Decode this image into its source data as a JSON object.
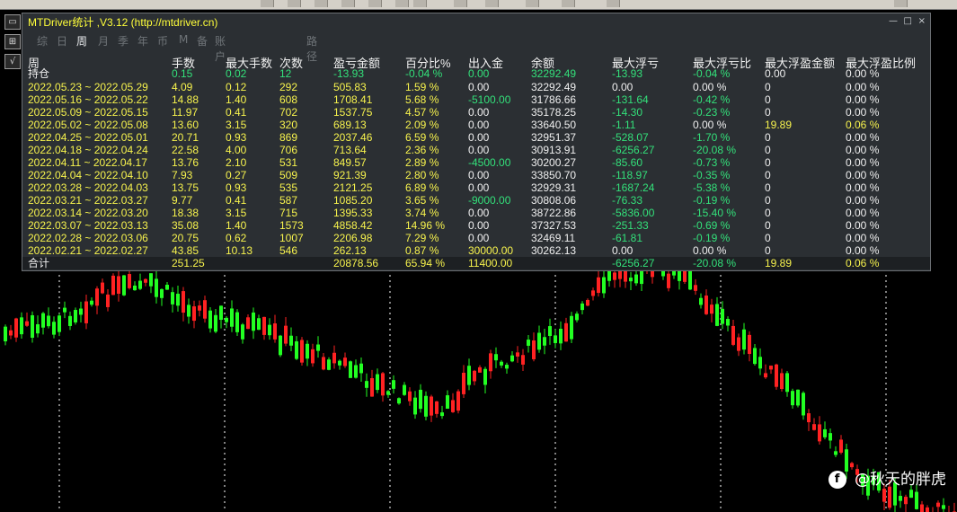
{
  "window": {
    "title": "MTDriver统计 ,V3.12 (http://mtdriver.cn)",
    "win_buttons": [
      "—",
      "□",
      "×"
    ]
  },
  "side_icons": [
    "▭",
    "⊞",
    "√"
  ],
  "tabs": [
    "综",
    "日",
    "周",
    "月",
    "季",
    "年",
    "币",
    "M",
    "备",
    "账户",
    "路径"
  ],
  "active_tab": "周",
  "headers": [
    "周",
    "手数",
    "最大手数",
    "次数",
    "盈亏金额",
    "百分比%",
    "出入金",
    "余额",
    "最大浮亏",
    "最大浮亏比",
    "最大浮盈金额",
    "最大浮盈比例"
  ],
  "holding": {
    "label": "持仓",
    "lots": "0.15",
    "maxlots": "0.02",
    "count": "12",
    "pnl": "-13.93",
    "pct": "-0.04 %",
    "flow": "0.00",
    "balance": "32292.49",
    "maxfl": "-13.93",
    "maxflp": "-0.04 %",
    "maxfp": "0.00",
    "maxfpp": "0.00 %"
  },
  "rows": [
    {
      "week": "2022.05.23 ~ 2022.05.29",
      "lots": "4.09",
      "maxlots": "0.12",
      "count": "292",
      "pnl": "505.83",
      "pct": "1.59 %",
      "flow": "0.00",
      "balance": "32292.49",
      "maxfl": "0.00",
      "maxflp": "0.00 %",
      "maxfp": "0",
      "maxfpp": "0.00 %"
    },
    {
      "week": "2022.05.16 ~ 2022.05.22",
      "lots": "14.88",
      "maxlots": "1.40",
      "count": "608",
      "pnl": "1708.41",
      "pct": "5.68 %",
      "flow": "-5100.00",
      "balance": "31786.66",
      "maxfl": "-131.64",
      "maxflp": "-0.42 %",
      "maxfp": "0",
      "maxfpp": "0.00 %"
    },
    {
      "week": "2022.05.09 ~ 2022.05.15",
      "lots": "11.97",
      "maxlots": "0.41",
      "count": "702",
      "pnl": "1537.75",
      "pct": "4.57 %",
      "flow": "0.00",
      "balance": "35178.25",
      "maxfl": "-14.30",
      "maxflp": "-0.23 %",
      "maxfp": "0",
      "maxfpp": "0.00 %"
    },
    {
      "week": "2022.05.02 ~ 2022.05.08",
      "lots": "13.60",
      "maxlots": "3.15",
      "count": "320",
      "pnl": "689.13",
      "pct": "2.09 %",
      "flow": "0.00",
      "balance": "33640.50",
      "maxfl": "-1.11",
      "maxflp": "0.00 %",
      "maxfp": "19.89",
      "maxfpp": "0.06 %"
    },
    {
      "week": "2022.04.25 ~ 2022.05.01",
      "lots": "20.71",
      "maxlots": "0.93",
      "count": "869",
      "pnl": "2037.46",
      "pct": "6.59 %",
      "flow": "0.00",
      "balance": "32951.37",
      "maxfl": "-528.07",
      "maxflp": "-1.70 %",
      "maxfp": "0",
      "maxfpp": "0.00 %"
    },
    {
      "week": "2022.04.18 ~ 2022.04.24",
      "lots": "22.58",
      "maxlots": "4.00",
      "count": "706",
      "pnl": "713.64",
      "pct": "2.36 %",
      "flow": "0.00",
      "balance": "30913.91",
      "maxfl": "-6256.27",
      "maxflp": "-20.08 %",
      "maxfp": "0",
      "maxfpp": "0.00 %"
    },
    {
      "week": "2022.04.11 ~ 2022.04.17",
      "lots": "13.76",
      "maxlots": "2.10",
      "count": "531",
      "pnl": "849.57",
      "pct": "2.89 %",
      "flow": "-4500.00",
      "balance": "30200.27",
      "maxfl": "-85.60",
      "maxflp": "-0.73 %",
      "maxfp": "0",
      "maxfpp": "0.00 %"
    },
    {
      "week": "2022.04.04 ~ 2022.04.10",
      "lots": "7.93",
      "maxlots": "0.27",
      "count": "509",
      "pnl": "921.39",
      "pct": "2.80 %",
      "flow": "0.00",
      "balance": "33850.70",
      "maxfl": "-118.97",
      "maxflp": "-0.35 %",
      "maxfp": "0",
      "maxfpp": "0.00 %"
    },
    {
      "week": "2022.03.28 ~ 2022.04.03",
      "lots": "13.75",
      "maxlots": "0.93",
      "count": "535",
      "pnl": "2121.25",
      "pct": "6.89 %",
      "flow": "0.00",
      "balance": "32929.31",
      "maxfl": "-1687.24",
      "maxflp": "-5.38 %",
      "maxfp": "0",
      "maxfpp": "0.00 %"
    },
    {
      "week": "2022.03.21 ~ 2022.03.27",
      "lots": "9.77",
      "maxlots": "0.41",
      "count": "587",
      "pnl": "1085.20",
      "pct": "3.65 %",
      "flow": "-9000.00",
      "balance": "30808.06",
      "maxfl": "-76.33",
      "maxflp": "-0.19 %",
      "maxfp": "0",
      "maxfpp": "0.00 %"
    },
    {
      "week": "2022.03.14 ~ 2022.03.20",
      "lots": "18.38",
      "maxlots": "3.15",
      "count": "715",
      "pnl": "1395.33",
      "pct": "3.74 %",
      "flow": "0.00",
      "balance": "38722.86",
      "maxfl": "-5836.00",
      "maxflp": "-15.40 %",
      "maxfp": "0",
      "maxfpp": "0.00 %"
    },
    {
      "week": "2022.03.07 ~ 2022.03.13",
      "lots": "35.08",
      "maxlots": "1.40",
      "count": "1573",
      "pnl": "4858.42",
      "pct": "14.96 %",
      "flow": "0.00",
      "balance": "37327.53",
      "maxfl": "-251.33",
      "maxflp": "-0.69 %",
      "maxfp": "0",
      "maxfpp": "0.00 %"
    },
    {
      "week": "2022.02.28 ~ 2022.03.06",
      "lots": "20.75",
      "maxlots": "0.62",
      "count": "1007",
      "pnl": "2206.98",
      "pct": "7.29 %",
      "flow": "0.00",
      "balance": "32469.11",
      "maxfl": "-61.81",
      "maxflp": "-0.19 %",
      "maxfp": "0",
      "maxfpp": "0.00 %"
    },
    {
      "week": "2022.02.21 ~ 2022.02.27",
      "lots": "43.85",
      "maxlots": "10.13",
      "count": "546",
      "pnl": "262.13",
      "pct": "0.87 %",
      "flow": "30000.00",
      "balance": "30262.13",
      "maxfl": "0.00",
      "maxflp": "0.00 %",
      "maxfp": "0",
      "maxfpp": "0.00 %"
    }
  ],
  "total": {
    "label": "合计",
    "lots": "251.25",
    "pnl": "20878.56",
    "pct": "65.94 %",
    "flow": "11400.00",
    "maxfl": "-6256.27",
    "maxflp": "-20.08 %",
    "maxfp": "19.89",
    "maxfpp": "0.06 %"
  },
  "watermark": {
    "logo": "f",
    "text": "@秋天的胖虎"
  },
  "colors": {
    "bull": "#ff2222",
    "bear": "#22ff22",
    "grid": "#ffffff",
    "panel_bg": "#2b2f33",
    "yellow": "#f7f34d",
    "green": "#33e07a"
  }
}
